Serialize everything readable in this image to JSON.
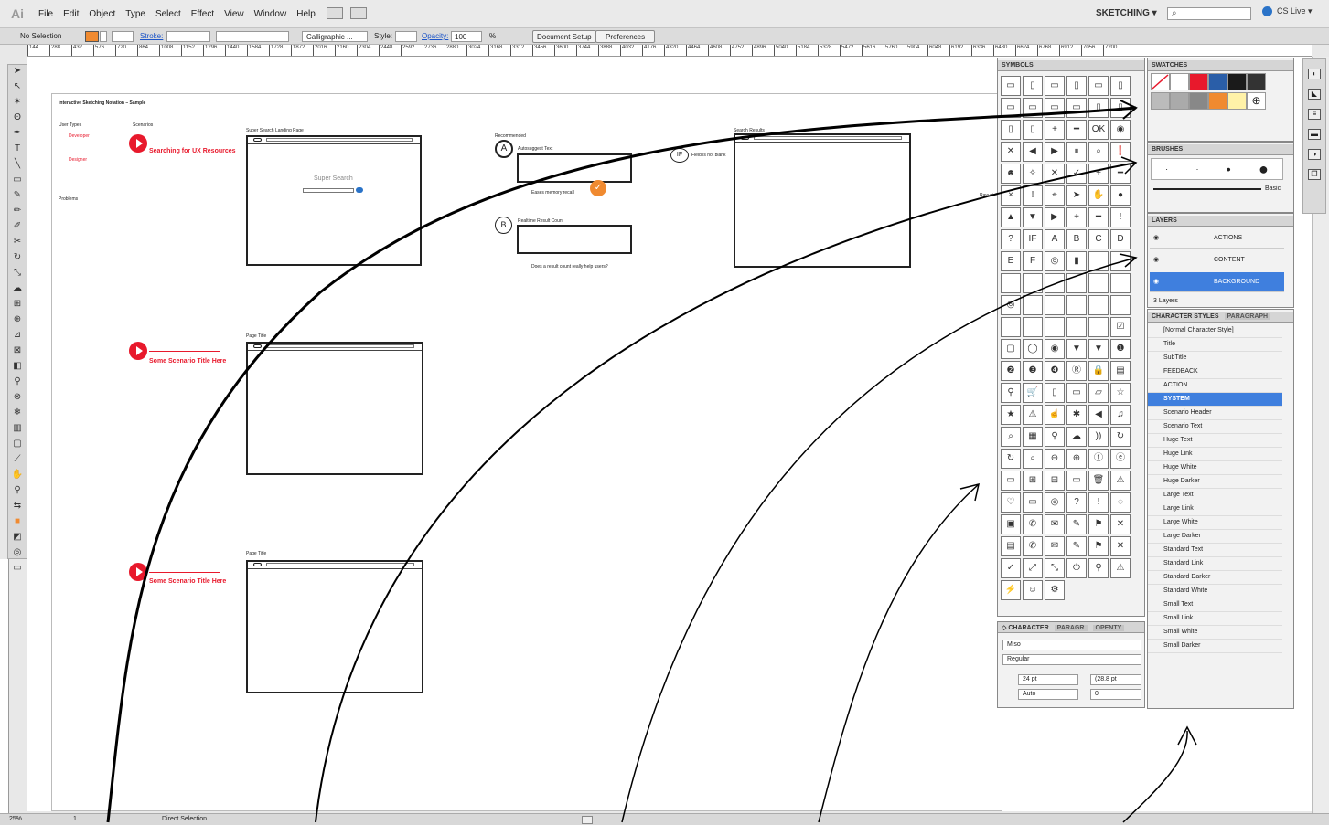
{
  "app": {
    "logo": "Ai",
    "menu": [
      "File",
      "Edit",
      "Object",
      "Type",
      "Select",
      "Effect",
      "View",
      "Window",
      "Help"
    ],
    "workspace": "SKETCHING",
    "cs_live": "CS Live"
  },
  "control": {
    "selection": "No Selection",
    "stroke_label": "Stroke:",
    "brush": "Calligraphic ...",
    "style_label": "Style:",
    "opacity_label": "Opacity:",
    "opacity_value": "100",
    "percent": "%",
    "doc_setup": "Document Setup",
    "preferences": "Preferences",
    "fill_color": "#f08a30"
  },
  "ruler": {
    "ticks": [
      "144",
      "288",
      "432",
      "576",
      "720",
      "864",
      "1008",
      "1152",
      "1296",
      "1440",
      "1584",
      "1728",
      "1872",
      "2016",
      "2160",
      "2304",
      "2448",
      "2592",
      "2736",
      "2880",
      "3024",
      "3168",
      "3312",
      "3456",
      "3600",
      "3744",
      "3888",
      "4032",
      "4176",
      "4320",
      "4464",
      "4608",
      "4752",
      "4896",
      "5040",
      "5184",
      "5328",
      "5472",
      "5616",
      "5760",
      "5904",
      "6048",
      "6192",
      "6336",
      "6480",
      "6624",
      "6768",
      "6912",
      "7056",
      "7200"
    ]
  },
  "artboard": {
    "title": "Interactive Sketching Notation – Sample",
    "user_types": "User Types",
    "scenarios": "Scenarios",
    "personas": [
      "Developer",
      "Designer"
    ],
    "problems": "Problems",
    "landing_caption": "Super Search Landing Page",
    "super_search": "Super Search",
    "results_caption": "Search Results",
    "scenario1": "Searching for UX Resources",
    "scenario2": "Some Scenario Title Here",
    "scenario3": "Some Scenario Title Here",
    "page_title": "Page Title",
    "autosuggest": "Autosuggest Text",
    "eases": "Eases memory recall",
    "realtime": "Realtime Result Count",
    "question": "Does a result count really help users?",
    "recommended": "Recommended",
    "iflabel": "IF",
    "field": "Field is not blank",
    "raw": "Raw visits to"
  },
  "symbols": {
    "title": "SYMBOLS"
  },
  "swatches": {
    "title": "SWATCHES",
    "colors": [
      "#ffffff",
      "#e8192c",
      "#2a5ea8",
      "#1a1a1a",
      "#333333",
      "#f08a30",
      "#fff2a8",
      "#ffffff",
      "#cccccc",
      "#999999"
    ]
  },
  "brushes": {
    "title": "BRUSHES",
    "basic": "Basic"
  },
  "layers": {
    "title": "LAYERS",
    "items": [
      "ACTIONS",
      "CONTENT",
      "BACKGROUND"
    ],
    "count": "3 Layers"
  },
  "charstyles": {
    "title": "CHARACTER STYLES",
    "tab2": "PARAGRAPH",
    "items": [
      "[Normal Character Style]",
      "Title",
      "SubTitle",
      "FEEDBACK",
      "ACTION",
      "SYSTEM",
      "Scenario Header",
      "Scenario Text",
      "Huge Text",
      "Huge Link",
      "Huge White",
      "Huge Darker",
      "Large Text",
      "Large Link",
      "Large White",
      "Large Darker",
      "Standard Text",
      "Standard Link",
      "Standard Darker",
      "Standard White",
      "Small Text",
      "Small Link",
      "Small White",
      "Small Darker"
    ],
    "selected": "SYSTEM"
  },
  "character": {
    "title": "CHARACTER",
    "tab2": "PARAGR",
    "tab3": "OPENTY",
    "font": "Miso",
    "style": "Regular",
    "size": "24 pt",
    "leading": "(28.8 pt",
    "kerning": "Auto",
    "tracking": "0"
  },
  "status": {
    "zoom": "25%",
    "page": "1",
    "tool": "Direct Selection"
  }
}
